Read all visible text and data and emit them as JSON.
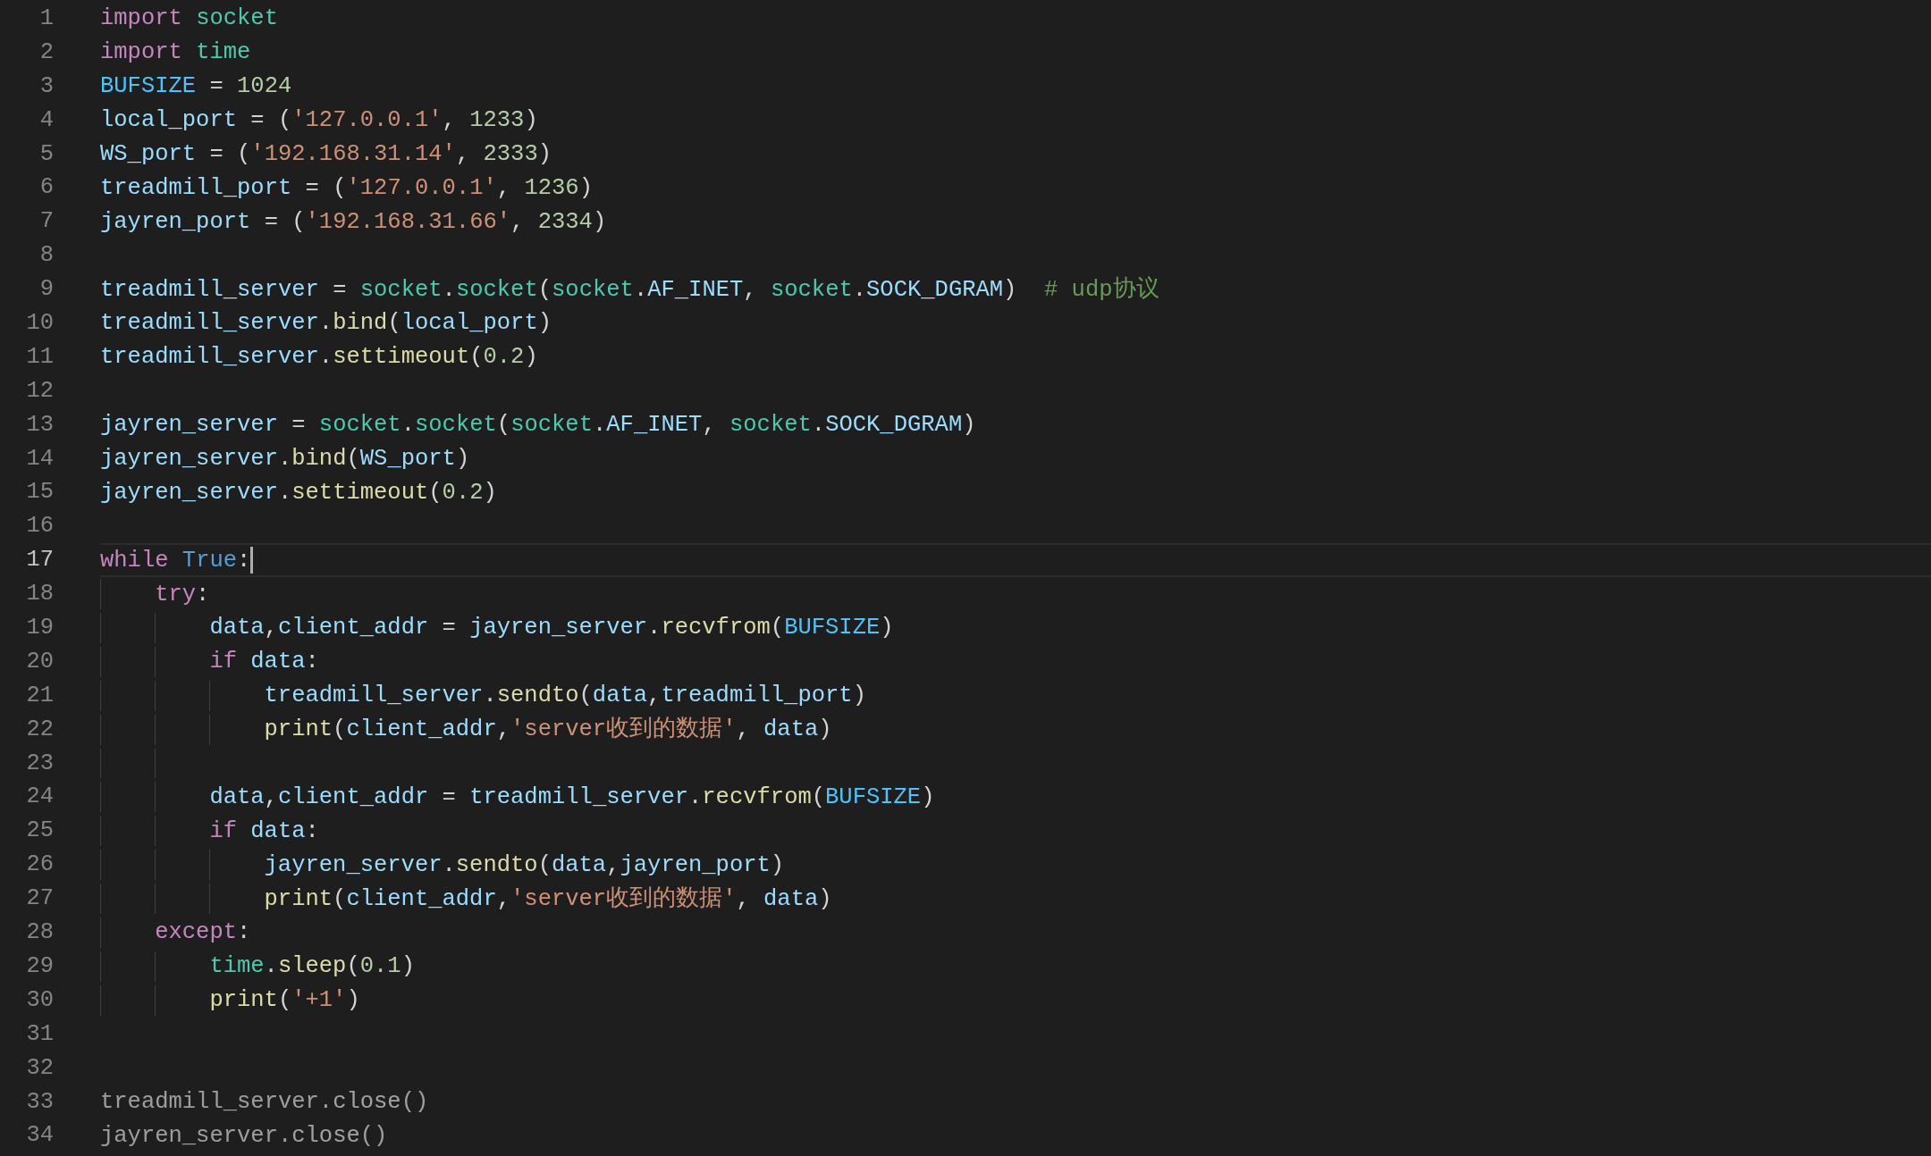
{
  "editor": {
    "lines": [
      {
        "number": "1",
        "tokens": [
          {
            "kind": "kw",
            "text": "import "
          },
          {
            "kind": "mod",
            "text": "socket"
          }
        ]
      },
      {
        "number": "2",
        "tokens": [
          {
            "kind": "kw",
            "text": "import "
          },
          {
            "kind": "mod",
            "text": "time"
          }
        ]
      },
      {
        "number": "3",
        "tokens": [
          {
            "kind": "const",
            "text": "BUFSIZE"
          },
          {
            "kind": "p",
            "text": " = "
          },
          {
            "kind": "num",
            "text": "1024"
          }
        ]
      },
      {
        "number": "4",
        "tokens": [
          {
            "kind": "var",
            "text": "local_port"
          },
          {
            "kind": "p",
            "text": " = ("
          },
          {
            "kind": "str",
            "text": "'127.0.0.1'"
          },
          {
            "kind": "p",
            "text": ", "
          },
          {
            "kind": "num",
            "text": "1233"
          },
          {
            "kind": "p",
            "text": ")"
          }
        ]
      },
      {
        "number": "5",
        "tokens": [
          {
            "kind": "var",
            "text": "WS_port"
          },
          {
            "kind": "p",
            "text": " = ("
          },
          {
            "kind": "str",
            "text": "'192.168.31.14'"
          },
          {
            "kind": "p",
            "text": ", "
          },
          {
            "kind": "num",
            "text": "2333"
          },
          {
            "kind": "p",
            "text": ")"
          }
        ]
      },
      {
        "number": "6",
        "tokens": [
          {
            "kind": "var",
            "text": "treadmill_port"
          },
          {
            "kind": "p",
            "text": " = ("
          },
          {
            "kind": "str",
            "text": "'127.0.0.1'"
          },
          {
            "kind": "p",
            "text": ", "
          },
          {
            "kind": "num",
            "text": "1236"
          },
          {
            "kind": "p",
            "text": ")"
          }
        ]
      },
      {
        "number": "7",
        "tokens": [
          {
            "kind": "var",
            "text": "jayren_port"
          },
          {
            "kind": "p",
            "text": " = ("
          },
          {
            "kind": "str",
            "text": "'192.168.31.66'"
          },
          {
            "kind": "p",
            "text": ", "
          },
          {
            "kind": "num",
            "text": "2334"
          },
          {
            "kind": "p",
            "text": ")"
          }
        ]
      },
      {
        "number": "8"
      },
      {
        "number": "9",
        "tokens": [
          {
            "kind": "var",
            "text": "treadmill_server"
          },
          {
            "kind": "p",
            "text": " = "
          },
          {
            "kind": "mod",
            "text": "socket"
          },
          {
            "kind": "p",
            "text": "."
          },
          {
            "kind": "mod",
            "text": "socket"
          },
          {
            "kind": "p",
            "text": "("
          },
          {
            "kind": "mod",
            "text": "socket"
          },
          {
            "kind": "p",
            "text": "."
          },
          {
            "kind": "var",
            "text": "AF_INET"
          },
          {
            "kind": "p",
            "text": ", "
          },
          {
            "kind": "mod",
            "text": "socket"
          },
          {
            "kind": "p",
            "text": "."
          },
          {
            "kind": "var",
            "text": "SOCK_DGRAM"
          },
          {
            "kind": "p",
            "text": ")  "
          },
          {
            "kind": "com",
            "text": "# udp协议"
          }
        ]
      },
      {
        "number": "10",
        "tokens": [
          {
            "kind": "var",
            "text": "treadmill_server"
          },
          {
            "kind": "p",
            "text": "."
          },
          {
            "kind": "fn",
            "text": "bind"
          },
          {
            "kind": "p",
            "text": "("
          },
          {
            "kind": "var",
            "text": "local_port"
          },
          {
            "kind": "p",
            "text": ")"
          }
        ]
      },
      {
        "number": "11",
        "tokens": [
          {
            "kind": "var",
            "text": "treadmill_server"
          },
          {
            "kind": "p",
            "text": "."
          },
          {
            "kind": "fn",
            "text": "settimeout"
          },
          {
            "kind": "p",
            "text": "("
          },
          {
            "kind": "num",
            "text": "0.2"
          },
          {
            "kind": "p",
            "text": ")"
          }
        ]
      },
      {
        "number": "12"
      },
      {
        "number": "13",
        "tokens": [
          {
            "kind": "var",
            "text": "jayren_server"
          },
          {
            "kind": "p",
            "text": " = "
          },
          {
            "kind": "mod",
            "text": "socket"
          },
          {
            "kind": "p",
            "text": "."
          },
          {
            "kind": "mod",
            "text": "socket"
          },
          {
            "kind": "p",
            "text": "("
          },
          {
            "kind": "mod",
            "text": "socket"
          },
          {
            "kind": "p",
            "text": "."
          },
          {
            "kind": "var",
            "text": "AF_INET"
          },
          {
            "kind": "p",
            "text": ", "
          },
          {
            "kind": "mod",
            "text": "socket"
          },
          {
            "kind": "p",
            "text": "."
          },
          {
            "kind": "var",
            "text": "SOCK_DGRAM"
          },
          {
            "kind": "p",
            "text": ")"
          }
        ]
      },
      {
        "number": "14",
        "tokens": [
          {
            "kind": "var",
            "text": "jayren_server"
          },
          {
            "kind": "p",
            "text": "."
          },
          {
            "kind": "fn",
            "text": "bind"
          },
          {
            "kind": "p",
            "text": "("
          },
          {
            "kind": "var",
            "text": "WS_port"
          },
          {
            "kind": "p",
            "text": ")"
          }
        ]
      },
      {
        "number": "15",
        "tokens": [
          {
            "kind": "var",
            "text": "jayren_server"
          },
          {
            "kind": "p",
            "text": "."
          },
          {
            "kind": "fn",
            "text": "settimeout"
          },
          {
            "kind": "p",
            "text": "("
          },
          {
            "kind": "num",
            "text": "0.2"
          },
          {
            "kind": "p",
            "text": ")"
          }
        ]
      },
      {
        "number": "16"
      },
      {
        "number": "17",
        "current": true,
        "tokens": [
          {
            "kind": "kw",
            "text": "while "
          },
          {
            "kind": "bool",
            "text": "True"
          },
          {
            "kind": "p",
            "text": ":"
          }
        ],
        "children": [
          {
            "number": "18",
            "tokens": [
              {
                "kind": "kw",
                "text": "try"
              },
              {
                "kind": "p",
                "text": ":"
              }
            ],
            "children": [
              {
                "number": "19",
                "tokens": [
                  {
                    "kind": "var",
                    "text": "data"
                  },
                  {
                    "kind": "p",
                    "text": ","
                  },
                  {
                    "kind": "var",
                    "text": "client_addr"
                  },
                  {
                    "kind": "p",
                    "text": " = "
                  },
                  {
                    "kind": "var",
                    "text": "jayren_server"
                  },
                  {
                    "kind": "p",
                    "text": "."
                  },
                  {
                    "kind": "fn",
                    "text": "recvfrom"
                  },
                  {
                    "kind": "p",
                    "text": "("
                  },
                  {
                    "kind": "const",
                    "text": "BUFSIZE"
                  },
                  {
                    "kind": "p",
                    "text": ")"
                  }
                ]
              },
              {
                "number": "20",
                "tokens": [
                  {
                    "kind": "kw",
                    "text": "if "
                  },
                  {
                    "kind": "var",
                    "text": "data"
                  },
                  {
                    "kind": "p",
                    "text": ":"
                  }
                ],
                "children": [
                  {
                    "number": "21",
                    "tokens": [
                      {
                        "kind": "var",
                        "text": "treadmill_server"
                      },
                      {
                        "kind": "p",
                        "text": "."
                      },
                      {
                        "kind": "fn",
                        "text": "sendto"
                      },
                      {
                        "kind": "p",
                        "text": "("
                      },
                      {
                        "kind": "var",
                        "text": "data"
                      },
                      {
                        "kind": "p",
                        "text": ","
                      },
                      {
                        "kind": "var",
                        "text": "treadmill_port"
                      },
                      {
                        "kind": "p",
                        "text": ")"
                      }
                    ]
                  },
                  {
                    "number": "22",
                    "tokens": [
                      {
                        "kind": "fn",
                        "text": "print"
                      },
                      {
                        "kind": "p",
                        "text": "("
                      },
                      {
                        "kind": "var",
                        "text": "client_addr"
                      },
                      {
                        "kind": "p",
                        "text": ","
                      },
                      {
                        "kind": "str",
                        "text": "'server收到的数据'"
                      },
                      {
                        "kind": "p",
                        "text": ", "
                      },
                      {
                        "kind": "var",
                        "text": "data"
                      },
                      {
                        "kind": "p",
                        "text": ")"
                      }
                    ]
                  }
                ]
              },
              {
                "number": "23"
              },
              {
                "number": "24",
                "tokens": [
                  {
                    "kind": "var",
                    "text": "data"
                  },
                  {
                    "kind": "p",
                    "text": ","
                  },
                  {
                    "kind": "var",
                    "text": "client_addr"
                  },
                  {
                    "kind": "p",
                    "text": " = "
                  },
                  {
                    "kind": "var",
                    "text": "treadmill_server"
                  },
                  {
                    "kind": "p",
                    "text": "."
                  },
                  {
                    "kind": "fn",
                    "text": "recvfrom"
                  },
                  {
                    "kind": "p",
                    "text": "("
                  },
                  {
                    "kind": "const",
                    "text": "BUFSIZE"
                  },
                  {
                    "kind": "p",
                    "text": ")"
                  }
                ]
              },
              {
                "number": "25",
                "tokens": [
                  {
                    "kind": "kw",
                    "text": "if "
                  },
                  {
                    "kind": "var",
                    "text": "data"
                  },
                  {
                    "kind": "p",
                    "text": ":"
                  }
                ],
                "children": [
                  {
                    "number": "26",
                    "tokens": [
                      {
                        "kind": "var",
                        "text": "jayren_server"
                      },
                      {
                        "kind": "p",
                        "text": "."
                      },
                      {
                        "kind": "fn",
                        "text": "sendto"
                      },
                      {
                        "kind": "p",
                        "text": "("
                      },
                      {
                        "kind": "var",
                        "text": "data"
                      },
                      {
                        "kind": "p",
                        "text": ","
                      },
                      {
                        "kind": "var",
                        "text": "jayren_port"
                      },
                      {
                        "kind": "p",
                        "text": ")"
                      }
                    ]
                  },
                  {
                    "number": "27",
                    "tokens": [
                      {
                        "kind": "fn",
                        "text": "print"
                      },
                      {
                        "kind": "p",
                        "text": "("
                      },
                      {
                        "kind": "var",
                        "text": "client_addr"
                      },
                      {
                        "kind": "p",
                        "text": ","
                      },
                      {
                        "kind": "str",
                        "text": "'server收到的数据'"
                      },
                      {
                        "kind": "p",
                        "text": ", "
                      },
                      {
                        "kind": "var",
                        "text": "data"
                      },
                      {
                        "kind": "p",
                        "text": ")"
                      }
                    ]
                  }
                ]
              }
            ]
          },
          {
            "number": "28",
            "tokens": [
              {
                "kind": "kw",
                "text": "except"
              },
              {
                "kind": "p",
                "text": ":"
              }
            ],
            "children": [
              {
                "number": "29",
                "tokens": [
                  {
                    "kind": "mod",
                    "text": "time"
                  },
                  {
                    "kind": "p",
                    "text": "."
                  },
                  {
                    "kind": "fn",
                    "text": "sleep"
                  },
                  {
                    "kind": "p",
                    "text": "("
                  },
                  {
                    "kind": "num",
                    "text": "0.1"
                  },
                  {
                    "kind": "p",
                    "text": ")"
                  }
                ]
              },
              {
                "number": "30",
                "tokens": [
                  {
                    "kind": "fn",
                    "text": "print"
                  },
                  {
                    "kind": "p",
                    "text": "("
                  },
                  {
                    "kind": "str",
                    "text": "'+1'"
                  },
                  {
                    "kind": "p",
                    "text": ")"
                  }
                ]
              }
            ]
          }
        ]
      },
      {
        "number": "31"
      },
      {
        "number": "32"
      },
      {
        "number": "33",
        "dimmed": true,
        "tokens": [
          {
            "kind": "var",
            "text": "treadmill_server"
          },
          {
            "kind": "p",
            "text": "."
          },
          {
            "kind": "fn",
            "text": "close"
          },
          {
            "kind": "p",
            "text": "()"
          }
        ]
      },
      {
        "number": "34",
        "dimmed": true,
        "tokens": [
          {
            "kind": "var",
            "text": "jayren_server"
          },
          {
            "kind": "p",
            "text": "."
          },
          {
            "kind": "fn",
            "text": "close"
          },
          {
            "kind": "p",
            "text": "()"
          }
        ]
      }
    ]
  }
}
